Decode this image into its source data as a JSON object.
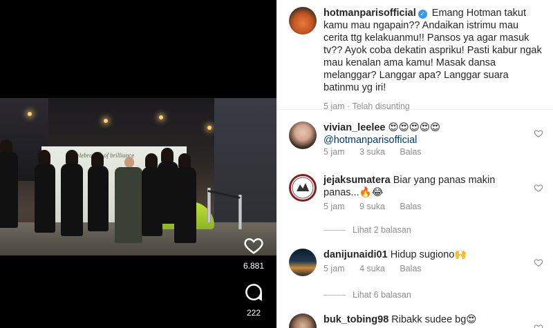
{
  "video": {
    "backdrop_text": "a celebration of brilliance",
    "likes_count": "6.881",
    "comments_count": "222"
  },
  "caption": {
    "username": "hotmanparisofficial",
    "verified": true,
    "text": "Emang Hotman takut kamu mau ngapain?? Andaikan istrimu mau cerita ttg kelakuanmu!! Pansos ya agar masuk tv?? Ayok coba dekatin aspriku! Pasti kabur ngak mau kenalan ama kamu! Masak dansa melanggar? Langgar apa? Langgar suara batinmu yg iri!",
    "time": "5 jam",
    "edited": "Telah disunting"
  },
  "comments": [
    {
      "username": "vivian_leelee",
      "text": "😍😍😍😍😍",
      "mention": "@hotmanparisofficial",
      "time": "5 jam",
      "likes": "3 suka",
      "reply": "Balas"
    },
    {
      "username": "jejaksumatera",
      "text": "Biar yang panas makin panas...🔥😂",
      "time": "5 jam",
      "likes": "9 suka",
      "reply": "Balas",
      "view_replies": "Lihat 2 balasan"
    },
    {
      "username": "danijunaidi01",
      "text": "Hidup sugiono🙌",
      "time": "5 jam",
      "likes": "4 suka",
      "reply": "Balas",
      "view_replies": "Lihat 6 balasan"
    },
    {
      "username": "buk_tobing98",
      "text": "Ribakk sudee bg😍"
    }
  ],
  "icons": {
    "heart": "heart-icon",
    "comment": "comment-bubble-icon",
    "verified": "verified-badge-icon"
  },
  "colors": {
    "verified": "#3897f0",
    "secondary_text": "#8e8e8e",
    "mention": "#00376b"
  }
}
